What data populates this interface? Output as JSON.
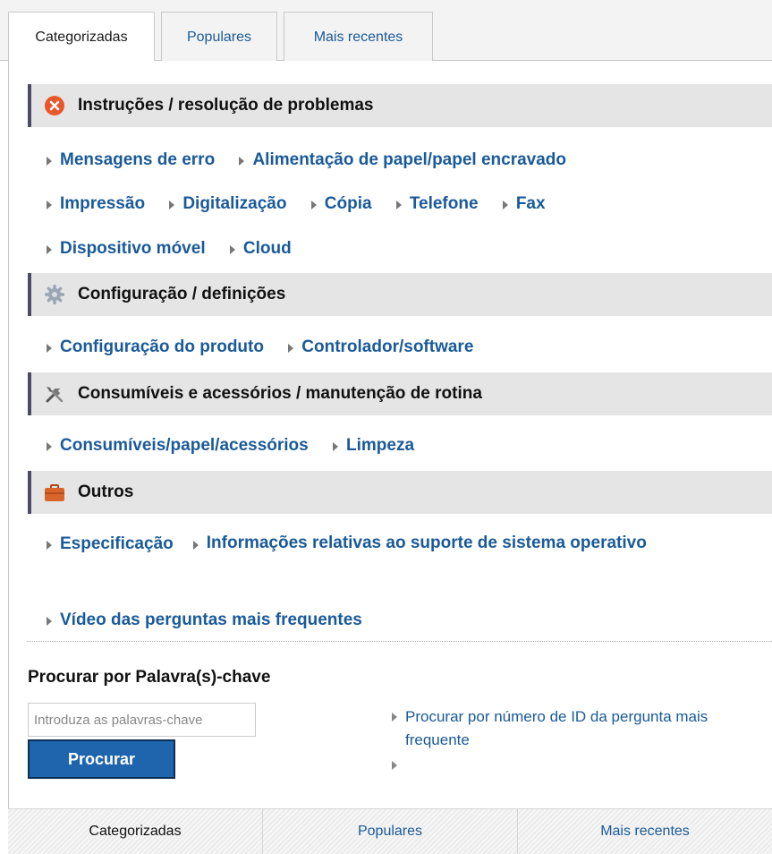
{
  "tabs": [
    {
      "label": "Categorizadas"
    },
    {
      "label": "Populares"
    },
    {
      "label": "Mais recentes"
    }
  ],
  "sections": [
    {
      "title": "Instruções / resolução de problemas",
      "icon": "error-circle-icon",
      "links": [
        "Mensagens de erro",
        "Alimentação de papel/papel encravado",
        "Impressão",
        "Digitalização",
        "Cópia",
        "Telefone",
        "Fax",
        "Dispositivo móvel",
        "Cloud"
      ]
    },
    {
      "title": "Configuração / definições",
      "icon": "gear-icon",
      "links": [
        "Configuração do produto",
        "Controlador/software"
      ]
    },
    {
      "title": "Consumíveis e acessórios / manutenção de rotina",
      "icon": "tools-icon",
      "links": [
        "Consumíveis/papel/acessórios",
        "Limpeza"
      ]
    },
    {
      "title": "Outros",
      "icon": "briefcase-icon",
      "links": [
        "Especificação",
        "Informações relativas ao suporte de sistema operativo",
        "Vídeo das perguntas mais frequentes"
      ]
    }
  ],
  "search": {
    "title": "Procurar por Palavra(s)-chave",
    "placeholder": "Introduza as palavras-chave",
    "button_label": "Procurar",
    "id_link": "Procurar por número de ID da pergunta mais frequente"
  },
  "colors": {
    "link": "#1a5a99",
    "button": "#1f65ad",
    "section_bar": "#4b4b67",
    "error_icon": "#e8572a",
    "briefcase_icon": "#d9652b"
  }
}
